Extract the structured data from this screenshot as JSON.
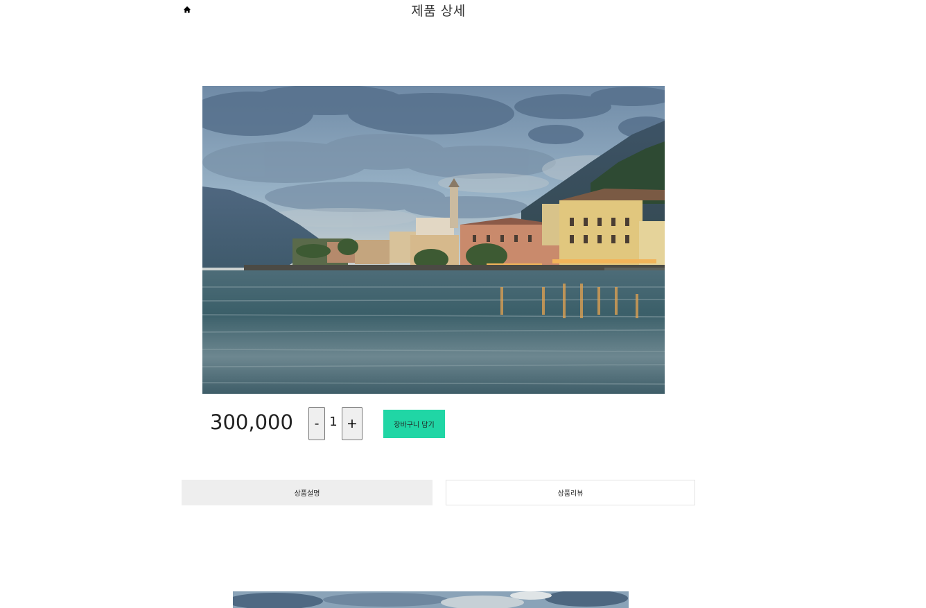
{
  "header": {
    "home_icon": "home-icon",
    "title": "제품 상세"
  },
  "product": {
    "image_subject": "lakeside-town-photo",
    "price": "300,000",
    "quantity": {
      "decrement_label": "-",
      "value": "1",
      "increment_label": "+"
    },
    "cart_button_label": "장바구니 담기"
  },
  "tabs": [
    {
      "label": "상품설명",
      "active": true
    },
    {
      "label": "상품리뷰",
      "active": false
    }
  ],
  "colors": {
    "accent": "#20d6a5",
    "active_tab_bg": "#eeeeee",
    "inactive_tab_border": "#e2e2e2"
  }
}
